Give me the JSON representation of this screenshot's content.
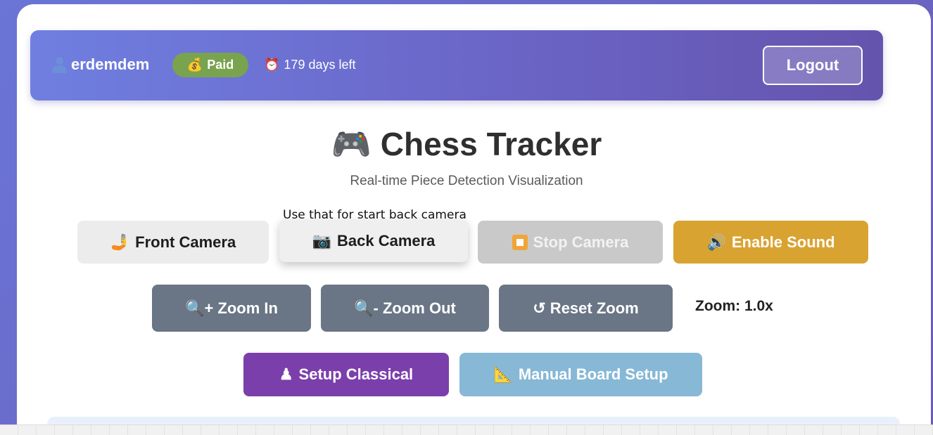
{
  "header": {
    "username": "erdemdem",
    "plan_badge": "Paid",
    "plan_icon": "💰",
    "time_icon": "⏰",
    "days_left": "179 days left",
    "logout_label": "Logout"
  },
  "hero": {
    "title_icon": "🎮",
    "title": "Chess Tracker",
    "subtitle": "Real-time Piece Detection Visualization"
  },
  "tooltip": "Use that for start back camera",
  "camera_buttons": {
    "front_icon": "🤳",
    "front": "Front Camera",
    "back_icon": "📷",
    "back": "Back Camera",
    "stop": "Stop Camera",
    "sound_icon": "🔊",
    "sound": "Enable Sound"
  },
  "zoom": {
    "in": "🔍+ Zoom In",
    "out": "🔍- Zoom Out",
    "reset": "↺ Reset Zoom",
    "level": "Zoom: 1.0x"
  },
  "setup": {
    "classical_icon": "♟",
    "classical": "Setup Classical",
    "manual_icon": "📐",
    "manual": "Manual Board Setup"
  },
  "colors": {
    "accent": "#6a63c4",
    "paid": "#79a34f",
    "sound": "#d9a332",
    "zoom": "#6a7585",
    "classical": "#7b3fab",
    "manual": "#87b8d6"
  }
}
